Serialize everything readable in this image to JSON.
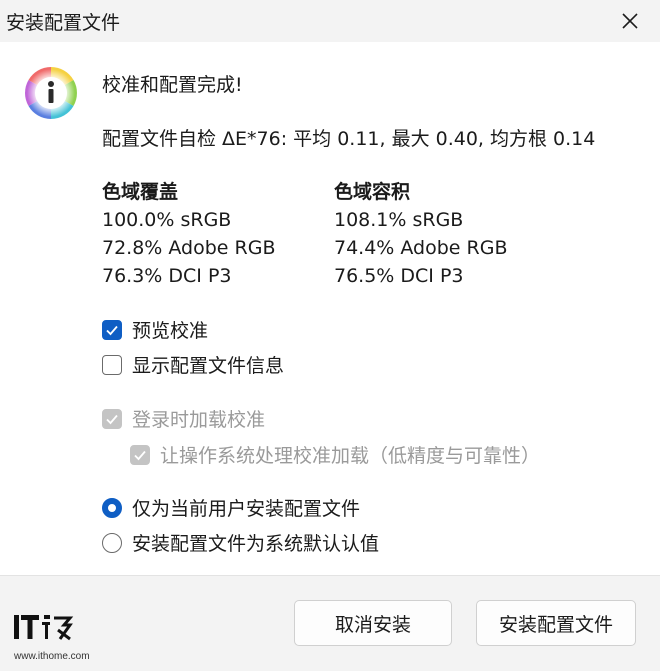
{
  "window": {
    "title": "安装配置文件",
    "close_icon": "close-icon"
  },
  "content": {
    "icon": "info-icon",
    "heading": "校准和配置完成!",
    "delta_line": "配置文件自检 ΔE*76: 平均 0.11, 最大 0.40, 均方根 0.14",
    "gamut_coverage": {
      "title": "色域覆盖",
      "rows": [
        "100.0% sRGB",
        "72.8% Adobe RGB",
        "76.3% DCI P3"
      ]
    },
    "gamut_volume": {
      "title": "色域容积",
      "rows": [
        "108.1% sRGB",
        "74.4% Adobe RGB",
        "76.5% DCI P3"
      ]
    },
    "options": {
      "preview_calibration": {
        "label": "预览校准",
        "checked": true
      },
      "show_profile_info": {
        "label": "显示配置文件信息",
        "checked": false
      },
      "load_on_login": {
        "label": "登录时加载校准",
        "checked": true,
        "disabled": true
      },
      "os_handle_calibration": {
        "label": "让操作系统处理校准加载（低精度与可靠性）",
        "checked": true,
        "disabled": true
      }
    },
    "install_scope": {
      "current_user": {
        "label": "仅为当前用户安装配置文件",
        "selected": true
      },
      "system_default": {
        "label": "安装配置文件为系统默认认值",
        "selected": false
      }
    }
  },
  "footer": {
    "cancel_label": "取消安装",
    "install_label": "安装配置文件",
    "logo_text": "IT之家",
    "logo_url": "www.ithome.com"
  },
  "colors": {
    "accent": "#0f5ec4",
    "window_bg": "#f3f3f3",
    "content_bg": "#ffffff",
    "disabled": "#c4c4c4"
  }
}
